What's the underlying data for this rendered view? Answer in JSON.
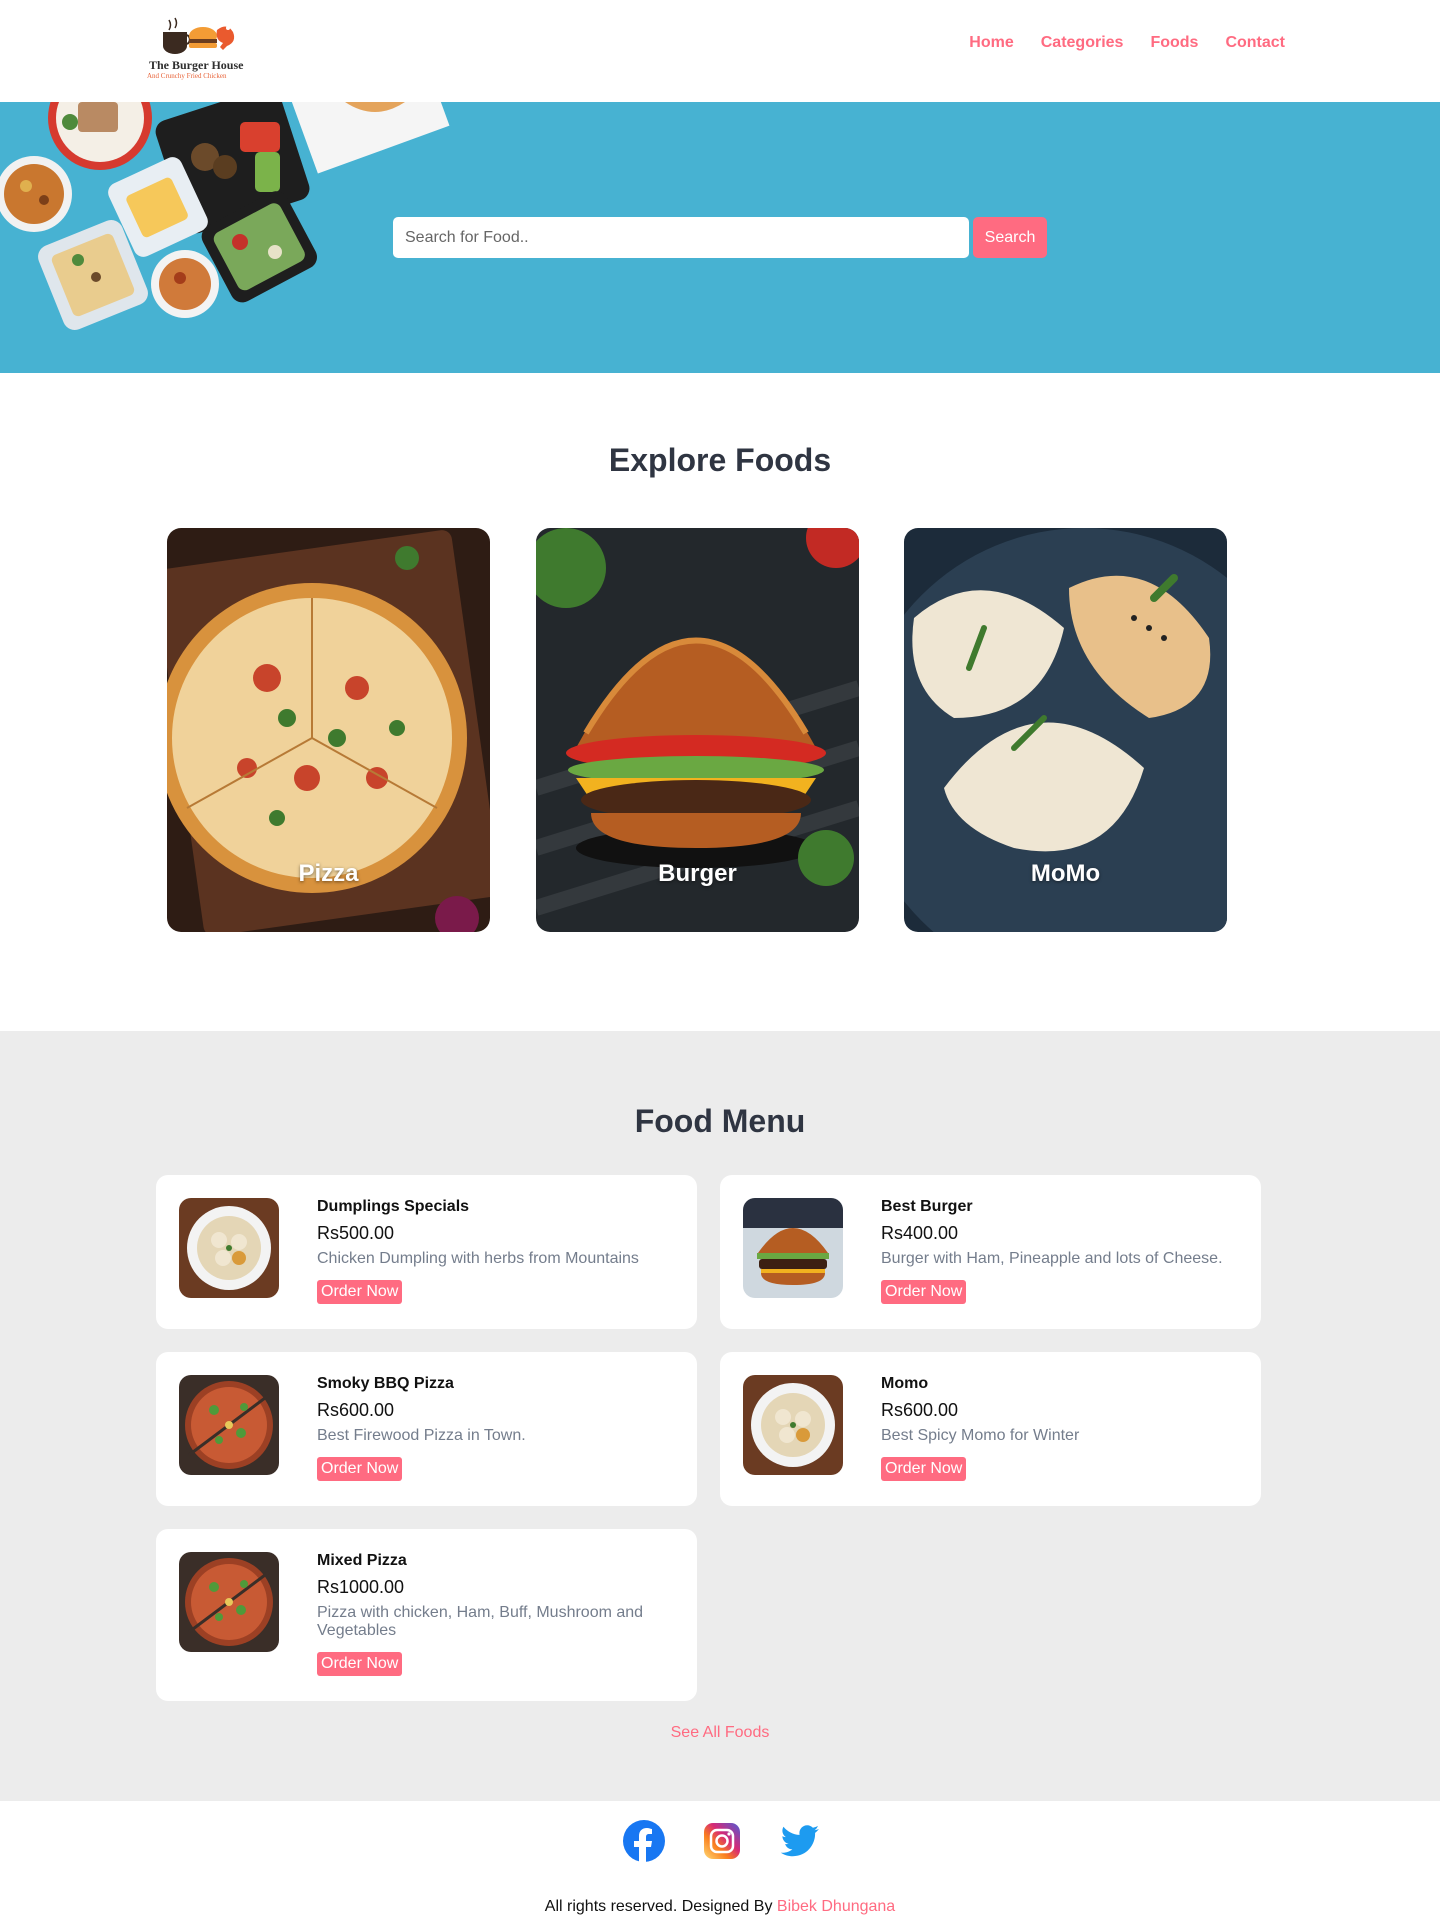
{
  "header": {
    "logo_title": "The Burger House",
    "logo_subtitle": "And Crunchy Fried Chicken",
    "nav": [
      "Home",
      "Categories",
      "Foods",
      "Contact"
    ]
  },
  "search": {
    "placeholder": "Search for Food..",
    "button_label": "Search"
  },
  "explore": {
    "title": "Explore Foods",
    "categories": [
      "Pizza",
      "Burger",
      "MoMo"
    ]
  },
  "menu": {
    "title": "Food Menu",
    "items": [
      {
        "name": "Dumplings Specials",
        "price": "Rs500.00",
        "description": "Chicken Dumpling with herbs from Mountains",
        "button": "Order Now",
        "image": "momo-plate"
      },
      {
        "name": "Best Burger",
        "price": "Rs400.00",
        "description": "Burger with Ham, Pineapple and lots of Cheese.",
        "button": "Order Now",
        "image": "burger"
      },
      {
        "name": "Smoky BBQ Pizza",
        "price": "Rs600.00",
        "description": "Best Firewood Pizza in Town.",
        "button": "Order Now",
        "image": "pizza"
      },
      {
        "name": "Momo",
        "price": "Rs600.00",
        "description": "Best Spicy Momo for Winter",
        "button": "Order Now",
        "image": "momo-plate"
      },
      {
        "name": "Mixed Pizza",
        "price": "Rs1000.00",
        "description": "Pizza with chicken, Ham, Buff, Mushroom and Vegetables",
        "button": "Order Now",
        "image": "pizza"
      }
    ],
    "see_all": "See All Foods"
  },
  "footer": {
    "social": [
      "facebook-icon",
      "instagram-icon",
      "twitter-icon"
    ],
    "copyright_text": "All rights reserved. Designed By ",
    "designer": "Bibek Dhungana"
  },
  "colors": {
    "accent": "#ff6b81",
    "hero_bg": "#47b2d2",
    "menu_bg": "#ececec",
    "heading": "#2f3542",
    "muted": "#747d8c"
  }
}
